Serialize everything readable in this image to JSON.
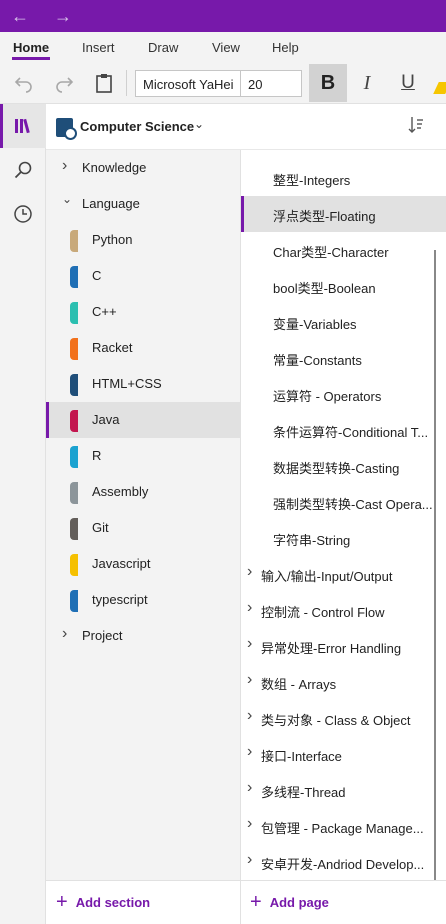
{
  "nav": {
    "back_icon": "back-arrow-icon",
    "forward_icon": "forward-arrow-icon"
  },
  "ribbon": {
    "tabs": [
      "Home",
      "Insert",
      "Draw",
      "View",
      "Help"
    ],
    "active_tab": "Home",
    "font_name": "Microsoft YaHei",
    "font_size": "20",
    "bold": "B",
    "italic": "I",
    "underline": "U"
  },
  "notebook": {
    "name": "Computer Science"
  },
  "sections": [
    {
      "label": "Knowledge",
      "type": "group",
      "expanded": false
    },
    {
      "label": "Language",
      "type": "group",
      "expanded": true
    },
    {
      "label": "Python",
      "color": "#c8a97a"
    },
    {
      "label": "C",
      "color": "#1f6fb5"
    },
    {
      "label": "C++",
      "color": "#2bbfb0"
    },
    {
      "label": "Racket",
      "color": "#f2711c"
    },
    {
      "label": "HTML+CSS",
      "color": "#1f4e79"
    },
    {
      "label": "Java",
      "color": "#c3164f",
      "selected": true
    },
    {
      "label": "R",
      "color": "#1ba2d0"
    },
    {
      "label": "Assembly",
      "color": "#8c959a"
    },
    {
      "label": "Git",
      "color": "#635e5a"
    },
    {
      "label": "Javascript",
      "color": "#f5c000"
    },
    {
      "label": "typescript",
      "color": "#1f6fb5"
    },
    {
      "label": "Project",
      "type": "group",
      "expanded": false
    }
  ],
  "pages": [
    {
      "label": "整型-Integers"
    },
    {
      "label": "浮点类型-Floating",
      "selected": true
    },
    {
      "label": "Char类型-Character"
    },
    {
      "label": "bool类型-Boolean"
    },
    {
      "label": "变量-Variables"
    },
    {
      "label": "常量-Constants"
    },
    {
      "label": "运算符 - Operators"
    },
    {
      "label": "条件运算符-Conditional T..."
    },
    {
      "label": "数据类型转换-Casting"
    },
    {
      "label": "强制类型转换-Cast Opera..."
    },
    {
      "label": "字符串-String"
    },
    {
      "label": "输入/输出-Input/Output",
      "group": true
    },
    {
      "label": "控制流 - Control Flow",
      "group": true
    },
    {
      "label": "异常处理-Error Handling",
      "group": true
    },
    {
      "label": "数组 - Arrays",
      "group": true
    },
    {
      "label": "类与对象 - Class & Object",
      "group": true
    },
    {
      "label": "接口-Interface",
      "group": true
    },
    {
      "label": "多线程-Thread",
      "group": true
    },
    {
      "label": "包管理 - Package Manage...",
      "group": true
    },
    {
      "label": "安卓开发-Andriod Develop...",
      "group": true
    }
  ],
  "footer": {
    "add_section": "Add section",
    "add_page": "Add page"
  },
  "colors": {
    "accent": "#7719aa",
    "highlight": "#f6c600"
  }
}
